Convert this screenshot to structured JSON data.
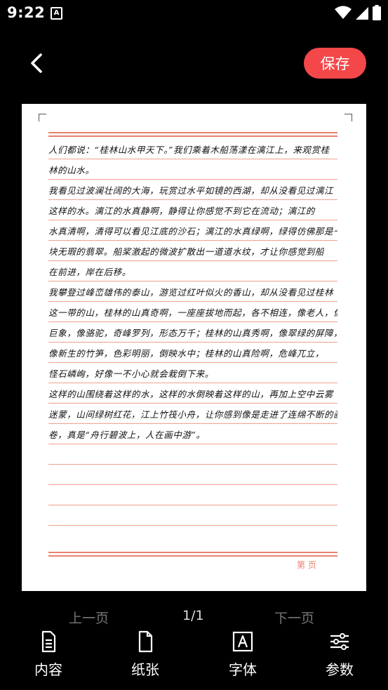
{
  "status": {
    "time": "9:22",
    "indicator": "A"
  },
  "header": {
    "save_label": "保存"
  },
  "paper": {
    "lines": [
      "人们都说：“桂林山水甲天下。”我们乘着木船荡漾在漓江上，来观赏桂",
      "林的山水。",
      "我看见过波澜壮阔的大海，玩赏过水平如镜的西湖，却从没看见过漓江",
      "这样的水。漓江的水真静啊，静得让你感觉不到它在流动；漓江的",
      "水真清啊，清得可以看见江底的沙石；漓江的水真绿啊，绿得仿佛那是一",
      "块无瑕的翡翠。船桨激起的微波扩散出一道道水纹，才让你感觉到船",
      "在前进，岸在后移。",
      "我攀登过峰峦雄伟的泰山，游览过红叶似火的香山，却从没看见过桂林",
      "这一带的山，桂林的山真奇啊，一座座拔地而起，各不相连，像老人，像",
      "巨象，像骆驼，奇峰罗列，形态万千；桂林的山真秀啊，像翠绿的屏障，",
      "像新生的竹笋，色彩明丽，倒映水中；桂林的山真险啊，危峰兀立，",
      "怪石嶙峋，好像一不小心就会栽倒下来。",
      "这样的山围绕着这样的水，这样的水倒映着这样的山，再加上空中云雾",
      "迷蒙，山间绿树红花，江上竹筏小舟，让你感到像是走进了连绵不断的画",
      "卷，真是“舟行碧波上，人在画中游”。"
    ],
    "page_label": "第    页"
  },
  "pager": {
    "prev": "上一页",
    "page": "1/1",
    "next": "下一页"
  },
  "nav": [
    {
      "label": "内容",
      "icon": "document-icon"
    },
    {
      "label": "纸张",
      "icon": "paper-icon"
    },
    {
      "label": "字体",
      "icon": "font-icon"
    },
    {
      "label": "参数",
      "icon": "sliders-icon"
    }
  ]
}
